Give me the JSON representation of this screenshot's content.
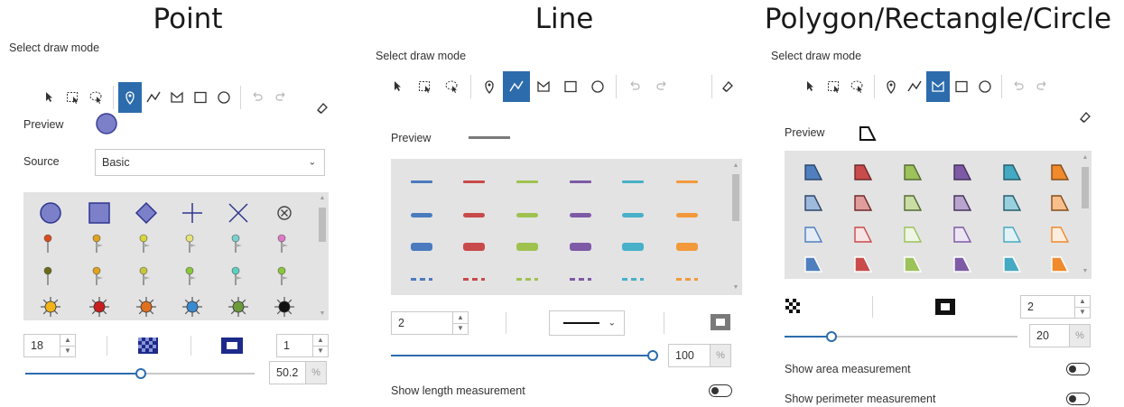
{
  "panels": {
    "point": {
      "heading": "Point",
      "draw_mode_label": "Select draw mode",
      "active_tool": "point",
      "preview_label": "Preview",
      "source_label": "Source",
      "source_value": "Basic",
      "size_value": "18",
      "outline_width_value": "1",
      "opacity_value": "50.2",
      "opacity_unit": "%",
      "opacity_fraction": 0.502
    },
    "line": {
      "heading": "Line",
      "draw_mode_label": "Select draw mode",
      "active_tool": "polyline",
      "preview_label": "Preview",
      "width_value": "2",
      "opacity_value": "100",
      "opacity_unit": "%",
      "opacity_fraction": 1.0,
      "show_length_label": "Show length measurement",
      "show_length_on": false
    },
    "polygon": {
      "heading": "Polygon/Rectangle/Circle",
      "draw_mode_label": "Select draw mode",
      "active_tool": "polygon",
      "preview_label": "Preview",
      "outline_width_value": "2",
      "opacity_value": "20",
      "opacity_unit": "%",
      "opacity_fraction": 0.2,
      "show_area_label": "Show area measurement",
      "show_area_on": false,
      "show_perimeter_label": "Show perimeter measurement",
      "show_perimeter_on": false
    }
  },
  "toolbar_icons": [
    "select-icon",
    "rectangle-select-icon",
    "lasso-select-icon",
    "point-icon",
    "polyline-icon",
    "polygon-icon",
    "rectangle-icon",
    "circle-icon",
    "undo-icon",
    "redo-icon"
  ],
  "colors": {
    "accent": "#2c6cad",
    "preview_point": "#7b80c9",
    "line_palette": [
      "#4a7bbf",
      "#c94a4a",
      "#9fc24f",
      "#7e5aa6",
      "#48b0c9",
      "#f29a3b"
    ],
    "polygon_palette": [
      "#4f7fbf",
      "#c94b4b",
      "#9cc25a",
      "#7e5aa6",
      "#44a9c2",
      "#f08a2c"
    ]
  }
}
